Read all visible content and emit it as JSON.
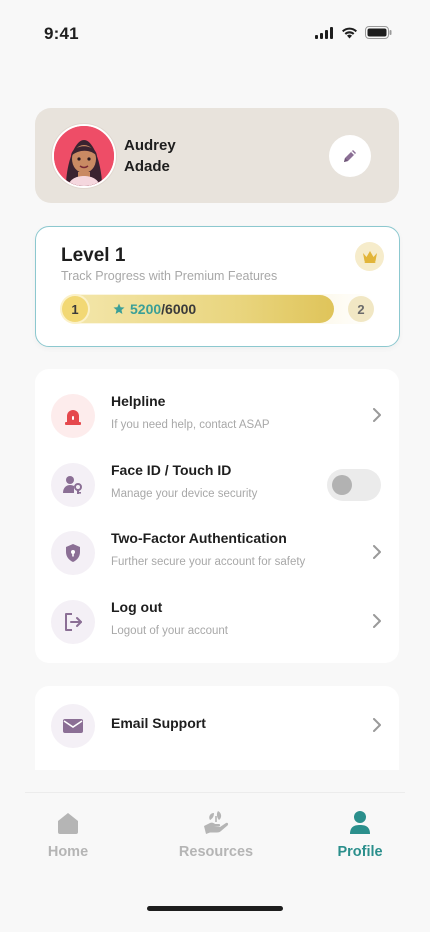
{
  "status_bar": {
    "time": "9:41",
    "icons": [
      "cellular-signal-icon",
      "wifi-icon",
      "battery-icon"
    ]
  },
  "profile": {
    "first_name": "Audrey",
    "last_name": "Adade",
    "edit_icon": "pencil-icon"
  },
  "level": {
    "title": "Level 1",
    "subtitle": "Track Progress with Premium Features",
    "current_level": "1",
    "next_level": "2",
    "points": "5200",
    "points_total": "/6000",
    "progress_fraction": 0.8667,
    "badge_icon": "crown-icon"
  },
  "settings": {
    "items": [
      {
        "title": "Helpline",
        "subtitle": "If you need help, contact ASAP",
        "icon": "alarm-siren-icon",
        "control": "chevron"
      },
      {
        "title": "Face ID / Touch ID",
        "subtitle": "Manage your device security",
        "icon": "user-key-icon",
        "control": "toggle",
        "toggle_on": false
      },
      {
        "title": "Two-Factor Authentication",
        "subtitle": "Further secure your account for safety",
        "icon": "shield-lock-icon",
        "control": "chevron"
      },
      {
        "title": "Log out",
        "subtitle": "Logout of your account",
        "icon": "logout-icon",
        "control": "chevron"
      }
    ]
  },
  "support": {
    "email_label": "Email Support",
    "icon": "envelope-icon"
  },
  "tabs": [
    {
      "label": "Home",
      "icon": "home-icon",
      "active": false
    },
    {
      "label": "Resources",
      "icon": "hand-leaf-icon",
      "active": false
    },
    {
      "label": "Profile",
      "icon": "person-icon",
      "active": true
    }
  ],
  "colors": {
    "accent": "#2b8f8c",
    "profile_card_bg": "#e8e3dc",
    "progress_gold": "#e9d57e",
    "helpline_red": "#e5484d",
    "icon_purple": "#8b6f95"
  }
}
